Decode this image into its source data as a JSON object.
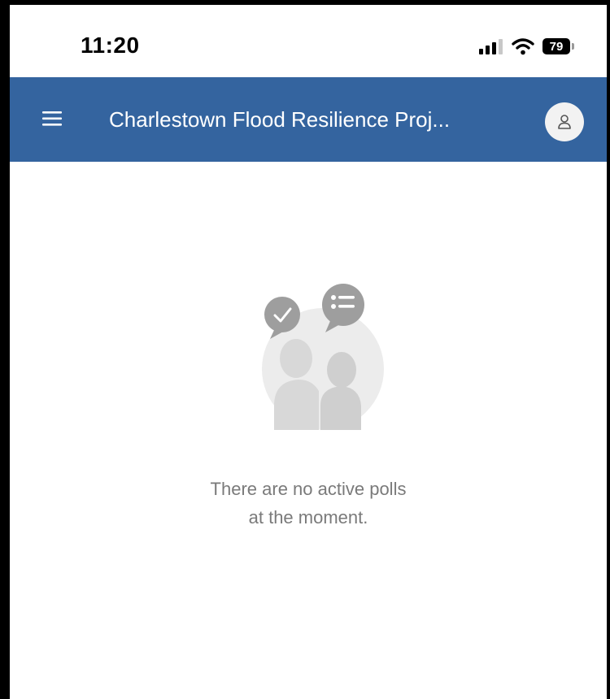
{
  "status_bar": {
    "time": "11:20",
    "battery_level": "79",
    "icons": [
      "cellular-signal-icon",
      "wifi-icon",
      "battery-icon"
    ]
  },
  "app_bar": {
    "title": "Charlestown Flood Resilience Proj...",
    "background_color": "#34649f",
    "icons": [
      "hamburger-menu-icon",
      "user-avatar-icon"
    ]
  },
  "empty_state": {
    "illustration": "people-discussion-icon",
    "message_line1": "There are no active polls",
    "message_line2": "at the moment."
  }
}
